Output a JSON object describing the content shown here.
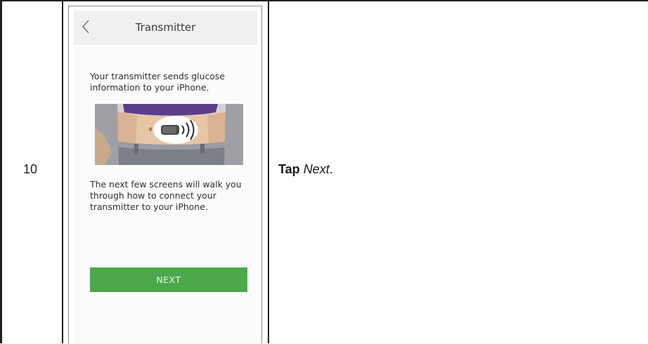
{
  "step": {
    "number": "10"
  },
  "phone": {
    "nav_title": "Transmitter",
    "intro_text": "Your transmitter sends glucose information to your iPhone.",
    "walkthrough_text": "The next few screens will walk you through how to connect your transmitter to your iPhone.",
    "next_button_label": "NEXT",
    "back_icon": "chevron-left-icon",
    "accent_color": "#4ca84a"
  },
  "instruction": {
    "verb": "Tap",
    "target": "Next",
    "punctuation": "."
  }
}
